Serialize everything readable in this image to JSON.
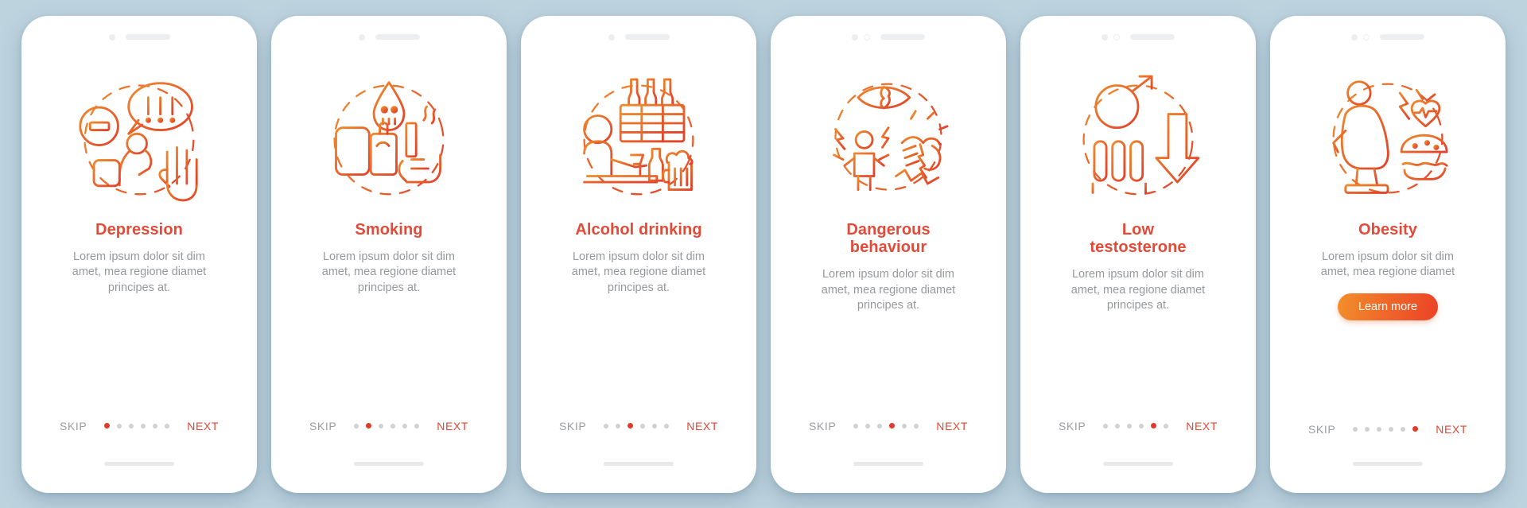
{
  "page": {
    "background_color": "#bdd3de",
    "accent_color": "#e34a38",
    "muted_text_color": "#96999c",
    "button_gradient": [
      "#f28f2b",
      "#ec4226"
    ]
  },
  "common": {
    "skip_label": "SKIP",
    "next_label": "NEXT",
    "body_text": "Lorem ipsum dolor sit dim\namet, mea regione diamet\nprincipes at.",
    "body_text_short": "Lorem ipsum dolor sit dim\namet, mea regione diamet",
    "total_dots": 6
  },
  "screens": [
    {
      "id": "depression",
      "title": "Depression",
      "body": "Lorem ipsum dolor sit dim\namet, mea regione diamet\nprincipes at.",
      "active_dot": 1,
      "illustration": "depression-illustration",
      "camera_style": "single",
      "has_learn_more": false,
      "skip_label": "SKIP",
      "next_label": "NEXT"
    },
    {
      "id": "smoking",
      "title": "Smoking",
      "body": "Lorem ipsum dolor sit dim\namet, mea regione diamet\nprincipes at.",
      "active_dot": 2,
      "illustration": "smoking-illustration",
      "camera_style": "single",
      "has_learn_more": false,
      "skip_label": "SKIP",
      "next_label": "NEXT"
    },
    {
      "id": "alcohol-drinking",
      "title": "Alcohol drinking",
      "body": "Lorem ipsum dolor sit dim\namet, mea regione diamet\nprincipes at.",
      "active_dot": 3,
      "illustration": "alcohol-illustration",
      "camera_style": "single",
      "has_learn_more": false,
      "skip_label": "SKIP",
      "next_label": "NEXT"
    },
    {
      "id": "dangerous-behaviour",
      "title": "Dangerous\nbehaviour",
      "body": "Lorem ipsum dolor sit dim\namet, mea regione diamet\nprincipes at.",
      "active_dot": 4,
      "illustration": "dangerous-behaviour-illustration",
      "camera_style": "double",
      "has_learn_more": false,
      "skip_label": "SKIP",
      "next_label": "NEXT"
    },
    {
      "id": "low-testosterone",
      "title": "Low\ntestosterone",
      "body": "Lorem ipsum dolor sit dim\namet, mea regione diamet\nprincipes at.",
      "active_dot": 5,
      "illustration": "low-testosterone-illustration",
      "camera_style": "double",
      "has_learn_more": false,
      "skip_label": "SKIP",
      "next_label": "NEXT"
    },
    {
      "id": "obesity",
      "title": "Obesity",
      "body": "Lorem ipsum dolor sit dim\namet, mea regione diamet",
      "active_dot": 6,
      "illustration": "obesity-illustration",
      "camera_style": "double",
      "has_learn_more": true,
      "learn_more_label": "Learn more",
      "skip_label": "SKIP",
      "next_label": "NEXT"
    }
  ]
}
